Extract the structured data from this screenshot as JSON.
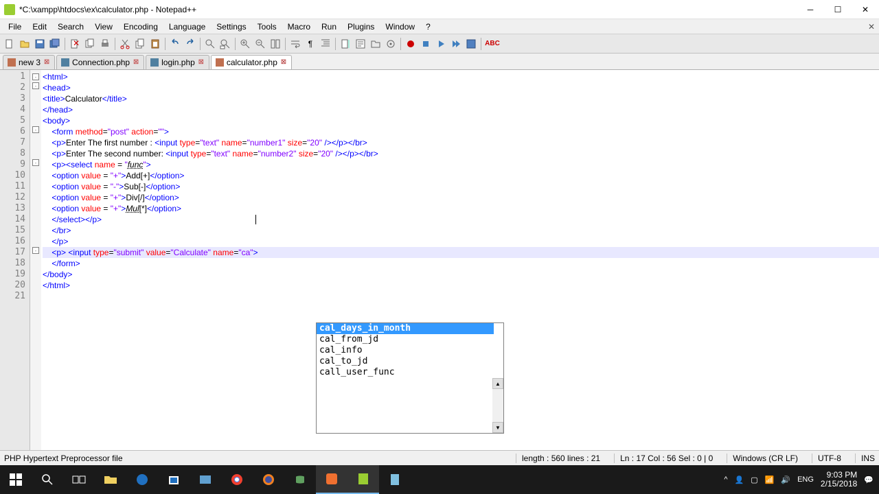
{
  "window": {
    "title": "*C:\\xampp\\htdocs\\ex\\calculator.php - Notepad++"
  },
  "menu": {
    "items": [
      "File",
      "Edit",
      "Search",
      "View",
      "Encoding",
      "Language",
      "Settings",
      "Tools",
      "Macro",
      "Run",
      "Plugins",
      "Window",
      "?"
    ]
  },
  "tabs": [
    {
      "label": "new 3",
      "dirty": true
    },
    {
      "label": "Connection.php",
      "dirty": false
    },
    {
      "label": "login.php",
      "dirty": false
    },
    {
      "label": "calculator.php",
      "dirty": true,
      "active": true
    }
  ],
  "code": {
    "lines": [
      {
        "n": 1,
        "html": "<span class='tag'>&lt;html&gt;</span>"
      },
      {
        "n": 2,
        "html": "<span class='tag'>&lt;head&gt;</span>"
      },
      {
        "n": 3,
        "html": "<span class='tag'>&lt;title&gt;</span><span class='text'>Calculator</span><span class='tag'>&lt;/title&gt;</span>"
      },
      {
        "n": 4,
        "html": "<span class='tag'>&lt;/head&gt;</span>"
      },
      {
        "n": 5,
        "html": "<span class='tag'>&lt;body&gt;</span>"
      },
      {
        "n": 6,
        "html": "    <span class='tag'>&lt;form</span> <span class='attr'>method</span>=<span class='str'>\"post\"</span> <span class='attr'>action</span>=<span class='str'>\"\"</span><span class='tag'>&gt;</span>"
      },
      {
        "n": 7,
        "html": "    <span class='tag'>&lt;p&gt;</span><span class='text'>Enter The first number : </span><span class='tag'>&lt;input</span> <span class='attr'>type</span>=<span class='str'>\"text\"</span> <span class='attr'>name</span>=<span class='str'>\"number1\"</span> <span class='attr'>size</span>=<span class='str'>\"20\"</span> <span class='tag'>/&gt;&lt;/p&gt;&lt;/br&gt;</span>"
      },
      {
        "n": 8,
        "html": "    <span class='tag'>&lt;p&gt;</span><span class='text'>Enter The second number: </span><span class='tag'>&lt;input</span> <span class='attr'>type</span>=<span class='str'>\"text\"</span> <span class='attr'>name</span>=<span class='str'>\"number2\"</span> <span class='attr'>size</span>=<span class='str'>\"20\"</span> <span class='tag'>/&gt;&lt;/p&gt;&lt;/br&gt;</span>"
      },
      {
        "n": 9,
        "html": "    <span class='tag'>&lt;p&gt;&lt;select</span> <span class='attr'>name</span> = <span class='str'>\"</span><span class='func'>func</span><span class='str'>\"</span><span class='tag'>&gt;</span>"
      },
      {
        "n": 10,
        "html": "    <span class='tag'>&lt;option</span> <span class='attr'>value</span> = <span class='str'>\"+\"</span><span class='tag'>&gt;</span><span class='text'>Add[+]</span><span class='tag'>&lt;/option&gt;</span>"
      },
      {
        "n": 11,
        "html": "    <span class='tag'>&lt;option</span> <span class='attr'>value</span> = <span class='str'>\"-\"</span><span class='tag'>&gt;</span><span class='text'>Sub[-]</span><span class='tag'>&lt;/option&gt;</span>"
      },
      {
        "n": 12,
        "html": "    <span class='tag'>&lt;option</span> <span class='attr'>value</span> = <span class='str'>\"+\"</span><span class='tag'>&gt;</span><span class='text'>Div[/]</span><span class='tag'>&lt;/option&gt;</span>"
      },
      {
        "n": 13,
        "html": "    <span class='tag'>&lt;option</span> <span class='attr'>value</span> = <span class='str'>\"+\"</span><span class='tag'>&gt;</span><span class='func'>Mul</span><span class='text'>[*]</span><span class='tag'>&lt;/option&gt;</span>"
      },
      {
        "n": 14,
        "html": "    <span class='tag'>&lt;/select&gt;&lt;/p&gt;</span>"
      },
      {
        "n": 15,
        "html": "    <span class='tag'>&lt;/br&gt;</span>"
      },
      {
        "n": 16,
        "html": "    <span class='tag'>&lt;/p&gt;</span>"
      },
      {
        "n": 17,
        "html": "    <span class='tag'>&lt;p&gt;</span> <span class='tag'>&lt;input</span> <span class='attr'>type</span>=<span class='str'>\"submit\"</span> <span class='attr'>value</span>=<span class='str'>\"Calculate\"</span> <span class='attr'>name</span>=<span class='str'>\"ca\"</span><span class='tag'>&gt;</span>"
      },
      {
        "n": 18,
        "html": "    <span class='tag'>&lt;/form&gt;</span>"
      },
      {
        "n": 19,
        "html": "<span class='tag'>&lt;/body&gt;</span>"
      },
      {
        "n": 20,
        "html": "<span class='tag'>&lt;/html&gt;</span>"
      },
      {
        "n": 21,
        "html": ""
      }
    ]
  },
  "autocomplete": {
    "items": [
      {
        "label": "cal_days_in_month",
        "selected": true
      },
      {
        "label": "cal_from_jd"
      },
      {
        "label": "cal_info"
      },
      {
        "label": "cal_to_jd"
      },
      {
        "label": "call_user_func"
      }
    ]
  },
  "status": {
    "filetype": "PHP Hypertext Preprocessor file",
    "length": "length : 560    lines : 21",
    "pos": "Ln : 17    Col : 56    Sel : 0 | 0",
    "eol": "Windows (CR LF)",
    "encoding": "UTF-8",
    "mode": "INS"
  },
  "clock": {
    "time": "9:03 PM",
    "date": "2/15/2018"
  },
  "tray": {
    "lang": "ENG"
  }
}
